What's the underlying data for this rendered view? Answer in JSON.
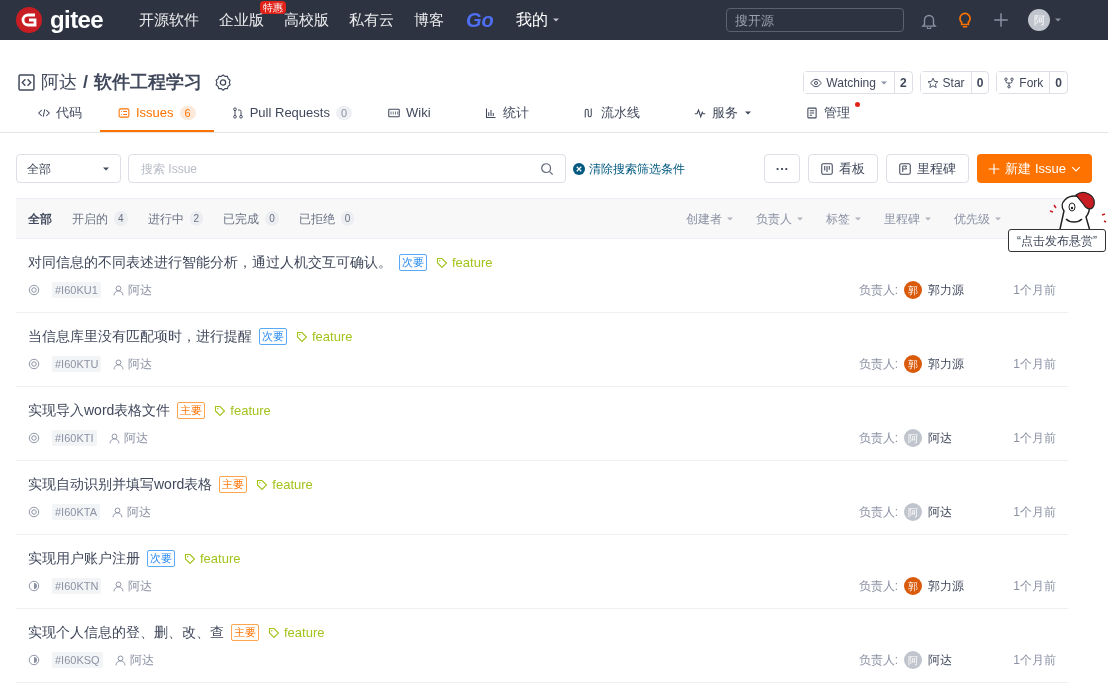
{
  "nav": {
    "logo": "gitee",
    "items": [
      {
        "label": "开源软件"
      },
      {
        "label": "企业版",
        "badge": "特惠"
      },
      {
        "label": "高校版"
      },
      {
        "label": "私有云"
      },
      {
        "label": "博客"
      },
      {
        "label": "Go",
        "kind": "go"
      },
      {
        "label": "我的",
        "kind": "menu"
      }
    ],
    "search": {
      "placeholder": "搜开源"
    },
    "avatar": "阿"
  },
  "repo": {
    "owner": "阿达",
    "name": "软件工程学习",
    "separator": "/",
    "actions": [
      {
        "label": "Watching",
        "count": "2",
        "caret": true
      },
      {
        "label": "Star",
        "count": "0"
      },
      {
        "label": "Fork",
        "count": "0"
      }
    ]
  },
  "tabs": [
    {
      "label": "代码",
      "selected": false
    },
    {
      "label": "Issues",
      "count": "6",
      "selected": true
    },
    {
      "label": "Pull Requests",
      "count": "0",
      "selected": false
    },
    {
      "label": "Wiki",
      "selected": false
    },
    {
      "label": "统计",
      "selected": false
    },
    {
      "label": "流水线",
      "selected": false
    },
    {
      "label": "服务",
      "caret": true,
      "selected": false
    },
    {
      "label": "管理",
      "dot": true,
      "selected": false
    }
  ],
  "toolbar": {
    "scope": "全部",
    "search_placeholder": "搜索 Issue",
    "clear": "清除搜索筛选条件",
    "more": "···",
    "board": "看板",
    "milestone": "里程碑",
    "new": "新建 Issue"
  },
  "filters": [
    {
      "label": "全部",
      "selected": true
    },
    {
      "label": "开启的",
      "count": "4",
      "selected": false
    },
    {
      "label": "进行中",
      "count": "2",
      "selected": false
    },
    {
      "label": "已完成",
      "count": "0",
      "selected": false
    },
    {
      "label": "已拒绝",
      "count": "0",
      "selected": false
    }
  ],
  "sorts": [
    "创建者",
    "负责人",
    "标签",
    "里程碑",
    "优先级"
  ],
  "bounty": "“点击发布悬赏”",
  "issues": [
    {
      "title": "对同信息的不同表述进行智能分析，通过人机交互可确认。",
      "priority": {
        "label": "次要",
        "kind": "minor"
      },
      "tag": "feature",
      "kind": "open",
      "id": "#I60KU1",
      "author": "阿达",
      "assignee_label": "负责人:",
      "assignee": {
        "avatar": "郭",
        "name": "郭力源",
        "color": "#da5a0b"
      },
      "time": "1个月前"
    },
    {
      "title": "当信息库里没有匹配项时，进行提醒",
      "priority": {
        "label": "次要",
        "kind": "minor"
      },
      "tag": "feature",
      "kind": "open",
      "id": "#I60KTU",
      "author": "阿达",
      "assignee_label": "负责人:",
      "assignee": {
        "avatar": "郭",
        "name": "郭力源",
        "color": "#da5a0b"
      },
      "time": "1个月前"
    },
    {
      "title": "实现导入word表格文件",
      "priority": {
        "label": "主要",
        "kind": "major"
      },
      "tag": "feature",
      "kind": "open",
      "id": "#I60KTI",
      "author": "阿达",
      "assignee_label": "负责人:",
      "assignee": {
        "avatar": "阿",
        "name": "阿达",
        "color": "#c0c4cc"
      },
      "time": "1个月前"
    },
    {
      "title": "实现自动识别并填写word表格",
      "priority": {
        "label": "主要",
        "kind": "major"
      },
      "tag": "feature",
      "kind": "open",
      "id": "#I60KTA",
      "author": "阿达",
      "assignee_label": "负责人:",
      "assignee": {
        "avatar": "阿",
        "name": "阿达",
        "color": "#c0c4cc"
      },
      "time": "1个月前"
    },
    {
      "title": "实现用户账户注册",
      "priority": {
        "label": "次要",
        "kind": "minor"
      },
      "tag": "feature",
      "kind": "progress",
      "id": "#I60KTN",
      "author": "阿达",
      "assignee_label": "负责人:",
      "assignee": {
        "avatar": "郭",
        "name": "郭力源",
        "color": "#da5a0b"
      },
      "time": "1个月前"
    },
    {
      "title": "实现个人信息的登、删、改、查",
      "priority": {
        "label": "主要",
        "kind": "major"
      },
      "tag": "feature",
      "kind": "progress",
      "id": "#I60KSQ",
      "author": "阿达",
      "assignee_label": "负责人:",
      "assignee": {
        "avatar": "阿",
        "name": "阿达",
        "color": "#c0c4cc"
      },
      "time": "1个月前"
    }
  ]
}
